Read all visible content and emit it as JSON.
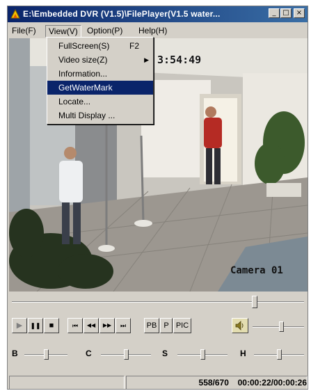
{
  "window": {
    "title": "E:\\Embedded DVR (V1.5)\\FilePlayer(V1.5 water...",
    "minimize_glyph": "_",
    "maximize_glyph": "□",
    "close_glyph": "×"
  },
  "menubar": {
    "items": [
      {
        "label": "File(F)"
      },
      {
        "label": "View(V)"
      },
      {
        "label": "Option(P)"
      },
      {
        "label": "Help(H)"
      }
    ]
  },
  "view_menu": {
    "items": [
      {
        "label": "FullScreen(S)",
        "shortcut": "F2"
      },
      {
        "label": "Video size(Z)",
        "submenu_glyph": "▶"
      },
      {
        "label": "Information..."
      },
      {
        "label": "GetWaterMark",
        "highlighted": true
      },
      {
        "label": "Locate..."
      },
      {
        "label": "Multi Display ..."
      }
    ]
  },
  "video": {
    "timestamp": "3:54:49",
    "camera_label": "Camera 01"
  },
  "playback": {
    "position_fraction": 0.83,
    "buttons": {
      "play": "▶",
      "pause": "❚❚",
      "stop": "■",
      "to_start": "⏮",
      "rewind": "◀◀",
      "fast_forward": "▶▶",
      "to_end": "⏭",
      "pb": "PB",
      "p": "P",
      "pic": "PIC"
    },
    "volume_icon": "speaker-icon",
    "volume_fraction": 0.55
  },
  "adjustments": [
    {
      "label": "B",
      "fraction": 0.5
    },
    {
      "label": "C",
      "fraction": 0.5
    },
    {
      "label": "S",
      "fraction": 0.5
    },
    {
      "label": "H",
      "fraction": 0.5
    }
  ],
  "status": {
    "frames": "558/670",
    "time": "00:00:22/00:00:26"
  },
  "colors": {
    "titlebar": "#0a246a",
    "highlight": "#0a246a",
    "chrome": "#d4d0c8"
  }
}
